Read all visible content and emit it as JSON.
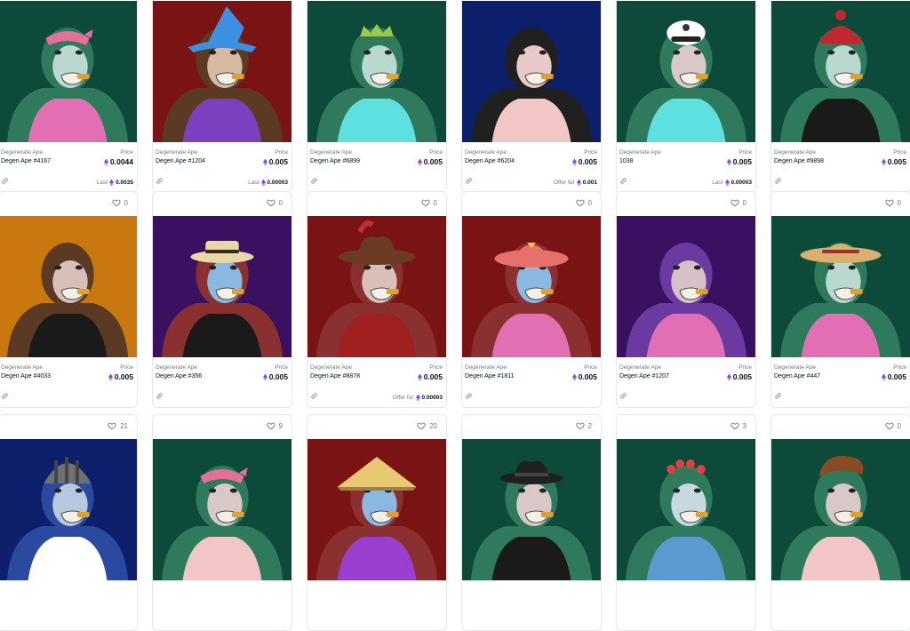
{
  "colors": {
    "eth_purple": "#8247e5",
    "border": "#e5e8eb",
    "muted_text": "#707a83"
  },
  "labels": {
    "price": "Price",
    "last": "Last",
    "offer_for": "Offer for"
  },
  "rows": [
    {
      "show_likes": false,
      "cards": [
        {
          "collection": "Degenerate Ape",
          "name": "Degen Ape #4167",
          "price": "0.0044",
          "footer_kind": "last",
          "footer_value": "0.0035",
          "bg": "#0e4a3a",
          "fur": "#2f7a5c",
          "face": "#b8d8d0",
          "shirt": "#e26fb3",
          "hat": "bandana",
          "hatcolor": "#e46f9a"
        },
        {
          "collection": "Degenerate Ape",
          "name": "Degen Ape #1204",
          "price": "0.005",
          "footer_kind": "last",
          "footer_value": "0.00003",
          "bg": "#7a1414",
          "fur": "#5a3a22",
          "face": "#d7b8a0",
          "shirt": "#7c3fc0",
          "hat": "wizard",
          "hatcolor": "#3d8fe0"
        },
        {
          "collection": "Degenerate Ape",
          "name": "Degen Ape #6899",
          "price": "0.005",
          "footer_kind": "none",
          "footer_value": "",
          "bg": "#0e4a3a",
          "fur": "#2f7a5c",
          "face": "#b8d8d0",
          "shirt": "#5ee0e0",
          "hat": "crown",
          "hatcolor": "#9bc94a"
        },
        {
          "collection": "Degenerate Ape",
          "name": "Degen Ape #6204",
          "price": "0.005",
          "footer_kind": "offer",
          "footer_value": "0.001",
          "bg": "#0d1f6b",
          "fur": "#202020",
          "face": "#e8c8c8",
          "shirt": "#f2c6c6",
          "hat": "none",
          "hatcolor": "#000"
        },
        {
          "collection": "Degenerate Ape",
          "name": "1038",
          "price": "0.005",
          "footer_kind": "last",
          "footer_value": "0.00003",
          "bg": "#0e4a3a",
          "fur": "#2f7a5c",
          "face": "#d8c8c8",
          "shirt": "#5ee0e0",
          "hat": "cap",
          "hatcolor": "#ffffff"
        },
        {
          "collection": "Degenerate Ape",
          "name": "Degen Ape #9898",
          "price": "0.005",
          "footer_kind": "none",
          "footer_value": "",
          "bg": "#0e4a3a",
          "fur": "#2f7a5c",
          "face": "#b8d8d0",
          "shirt": "#1a1a1a",
          "hat": "beanie",
          "hatcolor": "#c0282e"
        }
      ]
    },
    {
      "show_likes": true,
      "cards": [
        {
          "collection": "Degenerate Ape",
          "name": "Degen Ape #4033",
          "price": "0.005",
          "likes": "0",
          "footer_kind": "none",
          "footer_value": "",
          "bg": "#c8780e",
          "fur": "#5a3a22",
          "face": "#d8c0b8",
          "shirt": "#1a1a1a",
          "hat": "none",
          "hatcolor": "#000"
        },
        {
          "collection": "Degenerate Ape",
          "name": "Degen Ape #356",
          "price": "0.005",
          "likes": "0",
          "footer_kind": "none",
          "footer_value": "",
          "bg": "#3a1060",
          "fur": "#8a3030",
          "face": "#8ab8e0",
          "shirt": "#1a1a1a",
          "hat": "boater",
          "hatcolor": "#e8d8a8"
        },
        {
          "collection": "Degenerate Ape",
          "name": "Degen Ape #8878",
          "price": "0.005",
          "likes": "0",
          "footer_kind": "offer",
          "footer_value": "0.00003",
          "bg": "#7a1414",
          "fur": "#8a3030",
          "face": "#d8c0b8",
          "shirt": "#a02020",
          "hat": "cowboy",
          "hatcolor": "#6a3a22"
        },
        {
          "collection": "Degenerate Ape",
          "name": "Degen Ape #1811",
          "price": "0.005",
          "likes": "0",
          "footer_kind": "none",
          "footer_value": "",
          "bg": "#7a1414",
          "fur": "#8a3030",
          "face": "#8ab8e0",
          "shirt": "#e26fb3",
          "hat": "sunhat",
          "hatcolor": "#e8706a"
        },
        {
          "collection": "Degenerate Ape",
          "name": "Degen Ape #1207",
          "price": "0.005",
          "likes": "0",
          "footer_kind": "none",
          "footer_value": "",
          "bg": "#3a1060",
          "fur": "#6a3aa0",
          "face": "#d8c0c8",
          "shirt": "#e26fb3",
          "hat": "none",
          "hatcolor": "#000"
        },
        {
          "collection": "Degenerate Ape",
          "name": "Degen Ape #447",
          "price": "0.005",
          "likes": "0",
          "footer_kind": "none",
          "footer_value": "",
          "bg": "#0e4a3a",
          "fur": "#2f7a5c",
          "face": "#b8d8d0",
          "shirt": "#e26fb3",
          "hat": "straw",
          "hatcolor": "#d8b070"
        }
      ]
    },
    {
      "show_likes": true,
      "cards": [
        {
          "likes": "21",
          "bg": "#0d1f6b",
          "fur": "#2a4aa0",
          "face": "#b8c8e0",
          "shirt": "#ffffff",
          "hat": "helmet",
          "hatcolor": "#707070"
        },
        {
          "likes": "9",
          "bg": "#0e4a3a",
          "fur": "#2f7a5c",
          "face": "#d8c8c8",
          "shirt": "#f2c6c6",
          "hat": "bandana",
          "hatcolor": "#e46f9a"
        },
        {
          "likes": "20",
          "bg": "#7a1414",
          "fur": "#8a3030",
          "face": "#8ab8e0",
          "shirt": "#9a40d0",
          "hat": "conical",
          "hatcolor": "#e8c870"
        },
        {
          "likes": "2",
          "bg": "#0e4a3a",
          "fur": "#2f7a5c",
          "face": "#d8c8c8",
          "shirt": "#1a1a1a",
          "hat": "fedora",
          "hatcolor": "#202020"
        },
        {
          "likes": "3",
          "bg": "#0e4a3a",
          "fur": "#2f7a5c",
          "face": "#c8d8e0",
          "shirt": "#5a9ad0",
          "hat": "flowers",
          "hatcolor": "#e04040"
        },
        {
          "likes": "0",
          "bg": "#0e4a3a",
          "fur": "#2f7a5c",
          "face": "#d8c8c8",
          "shirt": "#f2c6c6",
          "hat": "pompadour",
          "hatcolor": "#8a4a22"
        }
      ]
    }
  ]
}
